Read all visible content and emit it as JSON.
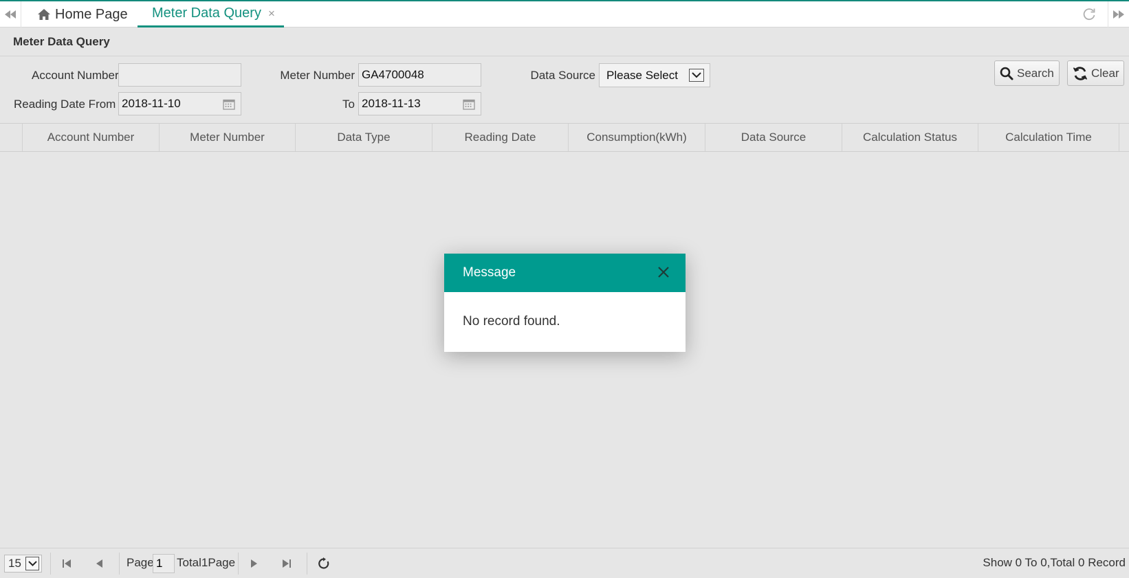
{
  "tabs": [
    {
      "label": "Home Page",
      "icon": "home-icon"
    },
    {
      "label": "Meter Data Query",
      "close": "×",
      "active": true
    }
  ],
  "page": {
    "title": "Meter Data Query"
  },
  "form": {
    "account_number": {
      "label": "Account Number",
      "value": ""
    },
    "meter_number": {
      "label": "Meter Number",
      "value": "GA4700048"
    },
    "data_source": {
      "label": "Data Source",
      "value": "Please Select"
    },
    "reading_date_from": {
      "label": "Reading Date From",
      "value": "2018-11-10"
    },
    "reading_date_to": {
      "label": "To",
      "value": "2018-11-13"
    }
  },
  "buttons": {
    "search": "Search",
    "clear": "Clear"
  },
  "grid": {
    "columns": [
      "Account Number",
      "Meter Number",
      "Data Type",
      "Reading Date",
      "Consumption(kWh)",
      "Data Source",
      "Calculation Status",
      "Calculation Time"
    ]
  },
  "dialog": {
    "title": "Message",
    "message": "No record found."
  },
  "pagination": {
    "page_size": "15",
    "page_label": "Page",
    "page_value": "1",
    "total_pages": "Total1Page",
    "info": "Show 0 To 0,Total 0 Record"
  },
  "colors": {
    "accent": "#13917f",
    "dialog_header": "#009b8f",
    "background": "#e6e6e6"
  }
}
